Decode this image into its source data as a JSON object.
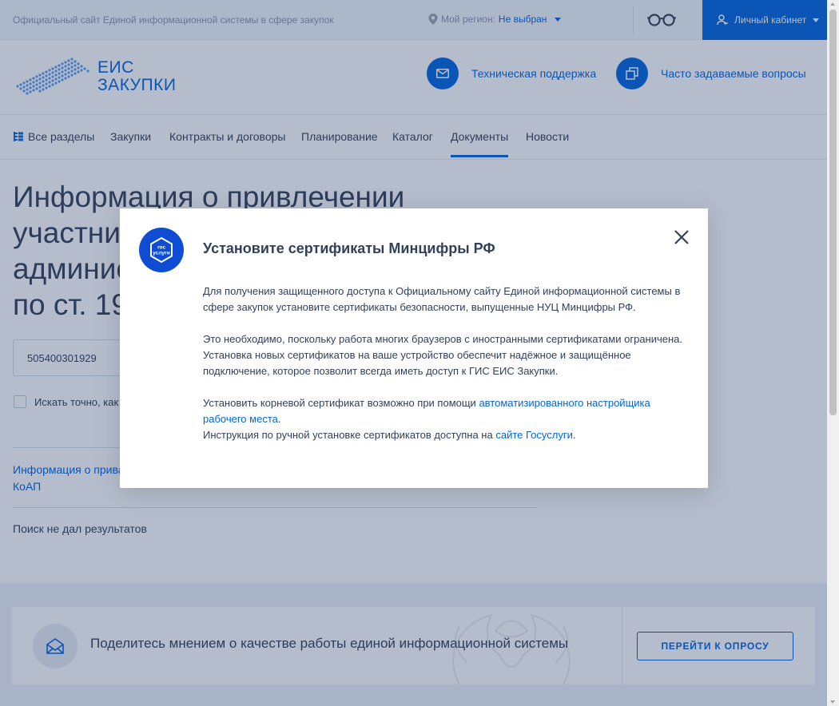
{
  "topbar": {
    "site_description": "Официальный сайт Единой информационной системы в сфере закупок",
    "region_label": "Мой регион:",
    "region_value": "Не выбран",
    "cabinet_label": "Личный кабинет"
  },
  "header": {
    "logo_line1": "ЕИС",
    "logo_line2": "ЗАКУПКИ",
    "support_label": "Техническая поддержка",
    "faq_label": "Часто задаваемые вопросы"
  },
  "nav": {
    "all_sections": "Все разделы",
    "items": [
      "Закупки",
      "Контракты и договоры",
      "Планирование",
      "Каталог",
      "Документы",
      "Новости"
    ],
    "active": "Документы"
  },
  "main": {
    "title": "Информация о привлечении участни... админис... по ст. 19...",
    "title_lines": [
      "Информация о привлечении",
      "участни",
      "админис",
      "по ст. 19"
    ],
    "search_value": "505400301929",
    "exact_search_label": "Искать точно, как",
    "result_link_line1": "Информация о прива",
    "result_link_line2": "КоАП",
    "no_results": "Поиск не дал результатов"
  },
  "survey": {
    "text": "Поделитесь мнением о качестве работы единой информационной системы",
    "button_label": "ПЕРЕЙТИ К ОПРОСУ"
  },
  "modal": {
    "logo_text_line1": "гос",
    "logo_text_line2": "услуги",
    "title": "Установите сертификаты Минцифры РФ",
    "para1": "Для получения защищенного доступа к Официальному сайту Единой информационной системы в сфере закупок установите сертификаты безопасности, выпущенные НУЦ Минцифры РФ.",
    "para2": "Это необходимо, поскольку работа многих браузеров с иностранными сертификатами ограничена. Установка новых сертификатов на ваше устройство обеспечит надёжное и защищённое подключение, которое позволит всегда иметь доступ к ГИС ЕИС Закупки.",
    "para3_prefix": "Установить корневой сертификат возможно при помощи ",
    "para3_link": "автоматизированного настройщика рабочего места",
    "para3_suffix": ".",
    "para4_prefix": "Инструкция по ручной установке сертификатов доступна на ",
    "para4_link": "сайте Госуслуги",
    "para4_suffix": "."
  },
  "colors": {
    "brand_blue": "#0065dd",
    "text": "#334059",
    "overlay": "rgba(30,56,101,0.33)",
    "gosuslugi_blue": "#0d4cd3"
  },
  "icons": [
    "location-pin-icon",
    "glasses-icon",
    "user-cabinet-icon",
    "mail-icon",
    "copy-icon",
    "sections-icon",
    "close-icon",
    "envelope-open-icon",
    "gosuslugi-logo"
  ]
}
